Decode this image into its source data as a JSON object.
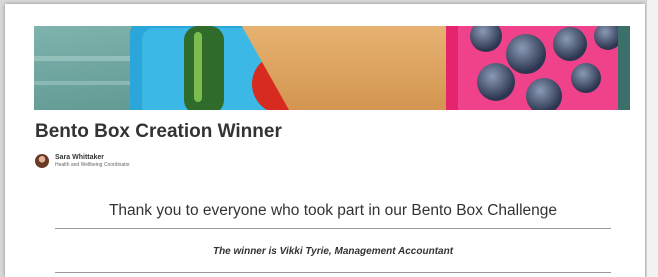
{
  "article": {
    "title": "Bento Box Creation Winner",
    "author": {
      "name": "Sara Whittaker",
      "role": "Health and Wellbeing Coordinator"
    },
    "thanks_heading": "Thank you to everyone who took part in our Bento Box Challenge",
    "winner_text": "The winner is Vikki Tyrie, Management Accountant"
  },
  "banner": {
    "depicts": "bento box with cucumber, tomatoes, sandwich and blueberries"
  }
}
